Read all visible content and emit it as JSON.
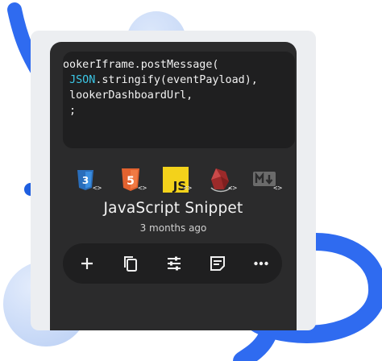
{
  "code": {
    "lines": [
      "ookerIframe.postMessage(",
      "JSON.stringify(eventPayload),",
      " lookerDashboardUrl,",
      " ;"
    ],
    "highlight_keyword": "JSON"
  },
  "languages": [
    {
      "name": "css3-icon",
      "badge": "<>"
    },
    {
      "name": "html5-icon",
      "badge": "<>"
    },
    {
      "name": "javascript-icon",
      "badge": "<>"
    },
    {
      "name": "sass-icon",
      "badge": "<>"
    },
    {
      "name": "markdown-icon",
      "badge": "<>"
    }
  ],
  "snippet": {
    "title": "JavaScript Snippet",
    "time": "3 months ago"
  },
  "toolbar": [
    "add-icon",
    "copy-icon",
    "tune-icon",
    "notes-icon",
    "more-icon"
  ],
  "colors": {
    "card": "#2b2b2c",
    "code_bg": "#1f1f20",
    "keyword": "#3cc7e6",
    "accent_blue": "#1f5fe0",
    "js_yellow": "#f3d21b",
    "html_orange": "#e2622f"
  }
}
